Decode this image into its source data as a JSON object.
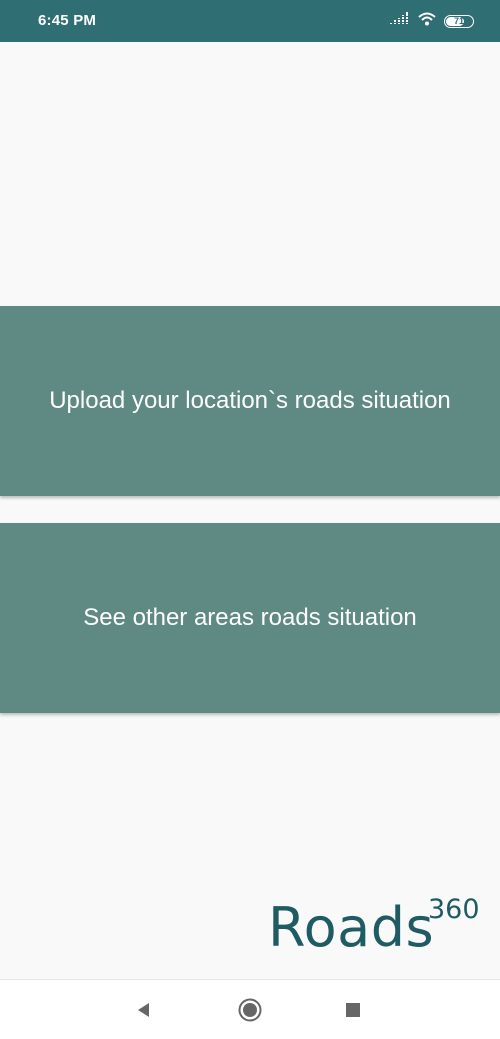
{
  "status_bar": {
    "time": "6:45 PM",
    "battery_level": "71",
    "battery_fraction": 0.71,
    "background_color": "#2f6f74",
    "icons": [
      "signal-icon",
      "wifi-icon",
      "battery-icon"
    ]
  },
  "actions": {
    "upload_label": "Upload your location`s roads situation",
    "see_label": "See other areas roads situation",
    "card_color": "#5f8a84"
  },
  "logo": {
    "main": "Roads",
    "sup": "360",
    "color": "#1f5b63"
  },
  "navigation": {
    "icons": [
      "back-icon",
      "home-icon",
      "recent-apps-icon"
    ]
  }
}
